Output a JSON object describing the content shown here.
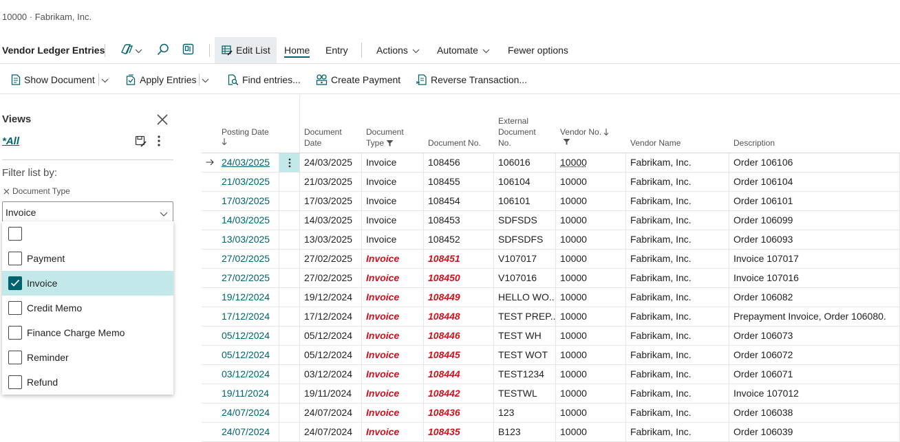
{
  "company": "10000 · Fabrikam, Inc.",
  "actionbar": {
    "page_title": "Vendor Ledger Entries",
    "edit_list": "Edit List",
    "home": "Home",
    "entry": "Entry",
    "actions": "Actions",
    "automate": "Automate",
    "fewer_options": "Fewer options"
  },
  "toolbar": {
    "show_document": "Show Document",
    "apply_entries": "Apply Entries",
    "find_entries": "Find entries...",
    "create_payment": "Create Payment",
    "reverse_transaction": "Reverse Transaction..."
  },
  "filter_pane": {
    "views_title": "Views",
    "all_view": "*All",
    "filter_label": "Filter list by:",
    "field_name": "Document Type",
    "selected_value": "Invoice",
    "options": [
      {
        "label": "",
        "checked": false
      },
      {
        "label": "Payment",
        "checked": false
      },
      {
        "label": "Invoice",
        "checked": true
      },
      {
        "label": "Credit Memo",
        "checked": false
      },
      {
        "label": "Finance Charge Memo",
        "checked": false
      },
      {
        "label": "Reminder",
        "checked": false
      },
      {
        "label": "Refund",
        "checked": false
      }
    ]
  },
  "table": {
    "headers": {
      "posting_date": "Posting Date",
      "document_date_1": "Document",
      "document_date_2": "Date",
      "document_type_1": "Document",
      "document_type_2": "Type",
      "document_no": "Document No.",
      "external_1": "External",
      "external_2": "Document",
      "external_3": "No.",
      "vendor_no": "Vendor No.",
      "vendor_name": "Vendor Name",
      "description": "Description"
    },
    "rows": [
      {
        "posting_date": "24/03/2025",
        "document_date": "24/03/2025",
        "document_type": "Invoice",
        "document_no": "108456",
        "external_doc_no": "106016",
        "vendor_no": "10000",
        "vendor_name": "Fabrikam, Inc.",
        "description": "Order 106106",
        "highlight": false
      },
      {
        "posting_date": "21/03/2025",
        "document_date": "21/03/2025",
        "document_type": "Invoice",
        "document_no": "108455",
        "external_doc_no": "106104",
        "vendor_no": "10000",
        "vendor_name": "Fabrikam, Inc.",
        "description": "Order 106104",
        "highlight": false
      },
      {
        "posting_date": "17/03/2025",
        "document_date": "17/03/2025",
        "document_type": "Invoice",
        "document_no": "108454",
        "external_doc_no": "106101",
        "vendor_no": "10000",
        "vendor_name": "Fabrikam, Inc.",
        "description": "Order 106101",
        "highlight": false
      },
      {
        "posting_date": "14/03/2025",
        "document_date": "14/03/2025",
        "document_type": "Invoice",
        "document_no": "108453",
        "external_doc_no": "SDFSDS",
        "vendor_no": "10000",
        "vendor_name": "Fabrikam, Inc.",
        "description": "Order 106099",
        "highlight": false
      },
      {
        "posting_date": "13/03/2025",
        "document_date": "13/03/2025",
        "document_type": "Invoice",
        "document_no": "108452",
        "external_doc_no": "SDFSDFS",
        "vendor_no": "10000",
        "vendor_name": "Fabrikam, Inc.",
        "description": "Order 106093",
        "highlight": false
      },
      {
        "posting_date": "27/02/2025",
        "document_date": "27/02/2025",
        "document_type": "Invoice",
        "document_no": "108451",
        "external_doc_no": "V107017",
        "vendor_no": "10000",
        "vendor_name": "Fabrikam, Inc.",
        "description": "Invoice 107017",
        "highlight": true
      },
      {
        "posting_date": "27/02/2025",
        "document_date": "27/02/2025",
        "document_type": "Invoice",
        "document_no": "108450",
        "external_doc_no": "V107016",
        "vendor_no": "10000",
        "vendor_name": "Fabrikam, Inc.",
        "description": "Invoice 107016",
        "highlight": true
      },
      {
        "posting_date": "19/12/2024",
        "document_date": "19/12/2024",
        "document_type": "Invoice",
        "document_no": "108449",
        "external_doc_no": "HELLO WO...",
        "vendor_no": "10000",
        "vendor_name": "Fabrikam, Inc.",
        "description": "Order 106082",
        "highlight": true
      },
      {
        "posting_date": "17/12/2024",
        "document_date": "17/12/2024",
        "document_type": "Invoice",
        "document_no": "108448",
        "external_doc_no": "TEST PREP...",
        "vendor_no": "10000",
        "vendor_name": "Fabrikam, Inc.",
        "description": "Prepayment Invoice, Order 106080.",
        "highlight": true
      },
      {
        "posting_date": "05/12/2024",
        "document_date": "05/12/2024",
        "document_type": "Invoice",
        "document_no": "108446",
        "external_doc_no": "TEST WH",
        "vendor_no": "10000",
        "vendor_name": "Fabrikam, Inc.",
        "description": "Order 106073",
        "highlight": true
      },
      {
        "posting_date": "05/12/2024",
        "document_date": "05/12/2024",
        "document_type": "Invoice",
        "document_no": "108445",
        "external_doc_no": "TEST WOT",
        "vendor_no": "10000",
        "vendor_name": "Fabrikam, Inc.",
        "description": "Order 106072",
        "highlight": true
      },
      {
        "posting_date": "03/12/2024",
        "document_date": "03/12/2024",
        "document_type": "Invoice",
        "document_no": "108444",
        "external_doc_no": "TEST1234",
        "vendor_no": "10000",
        "vendor_name": "Fabrikam, Inc.",
        "description": "Order 106071",
        "highlight": true
      },
      {
        "posting_date": "19/11/2024",
        "document_date": "19/11/2024",
        "document_type": "Invoice",
        "document_no": "108442",
        "external_doc_no": "TESTWL",
        "vendor_no": "10000",
        "vendor_name": "Fabrikam, Inc.",
        "description": "Invoice 107012",
        "highlight": true
      },
      {
        "posting_date": "24/07/2024",
        "document_date": "24/07/2024",
        "document_type": "Invoice",
        "document_no": "108436",
        "external_doc_no": "123",
        "vendor_no": "10000",
        "vendor_name": "Fabrikam, Inc.",
        "description": "Order 106038",
        "highlight": true
      },
      {
        "posting_date": "24/07/2024",
        "document_date": "24/07/2024",
        "document_type": "Invoice",
        "document_no": "108435",
        "external_doc_no": "B123",
        "vendor_no": "10000",
        "vendor_name": "Fabrikam, Inc.",
        "description": "Order 106039",
        "highlight": true
      }
    ]
  },
  "icons": {
    "copilot": "copilot-icon",
    "search": "search-icon",
    "share": "share-icon",
    "edit_list": "edit-list-icon",
    "show_document": "document-icon",
    "apply_entries": "apply-icon",
    "find_entries": "find-entries-icon",
    "create_payment": "payment-icon",
    "reverse": "reverse-icon",
    "close": "close-icon",
    "save_view": "save-view-icon",
    "more": "more-icon",
    "filter": "filter-icon",
    "row_arrow": "arrow-right-icon"
  },
  "colors": {
    "accent": "#00626c",
    "negative": "#d0111b",
    "selection": "#c3e8ea"
  }
}
